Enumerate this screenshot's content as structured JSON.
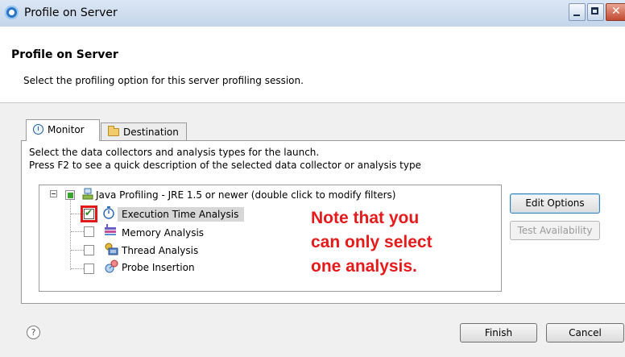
{
  "window": {
    "title": "Profile on Server"
  },
  "header": {
    "title": "Profile on Server",
    "description": "Select the profiling option for this server profiling session."
  },
  "tabs": [
    {
      "label": "Monitor",
      "icon": "monitor-icon",
      "active": true
    },
    {
      "label": "Destination",
      "icon": "folder-icon",
      "active": false
    }
  ],
  "panel": {
    "line1": "Select the data collectors and analysis types for the launch.",
    "line2": "Press F2 to see a quick description of the selected data collector or analysis type"
  },
  "tree": {
    "root": {
      "label": "Java Profiling - JRE 1.5 or newer (double click to modify filters)",
      "state": "partial"
    },
    "items": [
      {
        "label": "Execution Time Analysis",
        "checked": true,
        "icon": "stopwatch-icon"
      },
      {
        "label": "Memory Analysis",
        "checked": false,
        "icon": "memory-icon"
      },
      {
        "label": "Thread Analysis",
        "checked": false,
        "icon": "thread-icon"
      },
      {
        "label": "Probe Insertion",
        "checked": false,
        "icon": "probe-icon"
      }
    ]
  },
  "buttons": {
    "edit_options": "Edit Options",
    "test_availability": "Test Availability",
    "finish": "Finish",
    "cancel": "Cancel",
    "help": "?"
  },
  "annotation": {
    "line1": "Note that you",
    "line2": "can only select",
    "line3": "one analysis."
  },
  "colors": {
    "annotation": "#e61a1a",
    "highlight_box": "#e01818",
    "selection": "#d7d7d7"
  }
}
